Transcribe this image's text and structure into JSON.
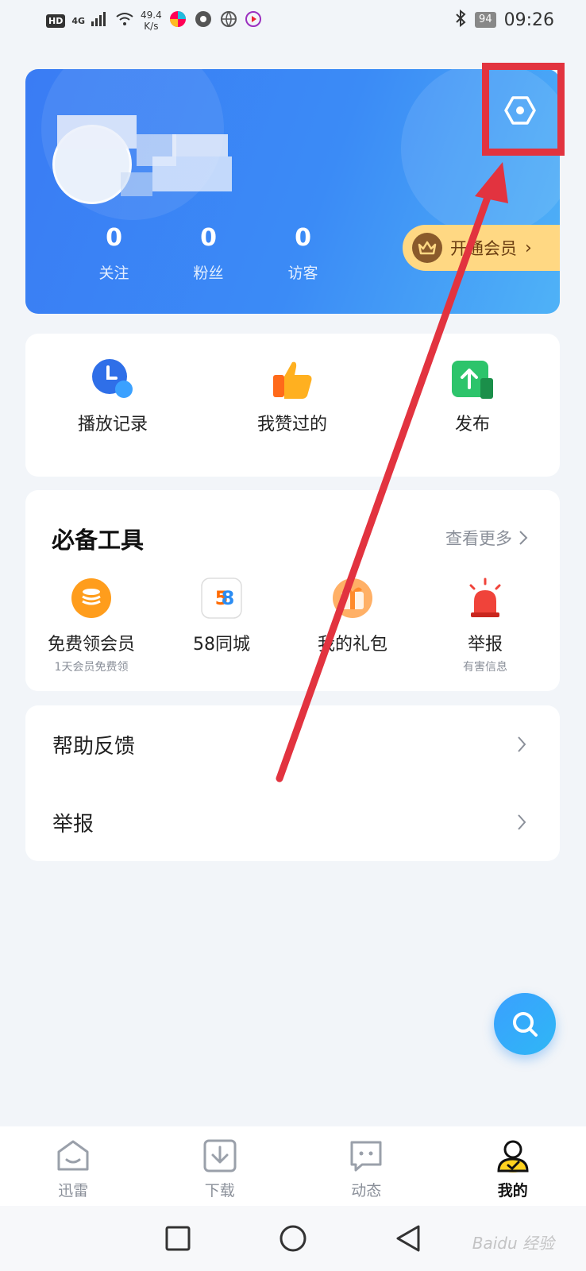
{
  "status_bar": {
    "hd": "HD",
    "network": "4G",
    "speed_value": "49.4",
    "speed_unit": "K/s",
    "battery": "94",
    "time": "09:26"
  },
  "profile": {
    "stats": [
      {
        "value": "0",
        "label": "关注"
      },
      {
        "value": "0",
        "label": "粉丝"
      },
      {
        "value": "0",
        "label": "访客"
      }
    ],
    "vip_label": "开通会员",
    "vip_chevron": "›"
  },
  "quick_actions": [
    {
      "label": "播放记录",
      "icon": "clock-icon"
    },
    {
      "label": "我赞过的",
      "icon": "thumbs-up-icon"
    },
    {
      "label": "发布",
      "icon": "upload-icon"
    }
  ],
  "tools": {
    "title": "必备工具",
    "more_label": "查看更多",
    "items": [
      {
        "label": "免费领会员",
        "sub": "1天会员免费领",
        "icon": "coin-stack-icon"
      },
      {
        "label": "58同城",
        "sub": "",
        "icon": "58-logo-icon"
      },
      {
        "label": "我的礼包",
        "sub": "",
        "icon": "gift-icon"
      },
      {
        "label": "举报",
        "sub": "有害信息",
        "icon": "alarm-icon"
      }
    ]
  },
  "menu": [
    {
      "label": "帮助反馈"
    },
    {
      "label": "举报"
    }
  ],
  "tabbar": [
    {
      "label": "迅雷",
      "icon": "home-icon",
      "active": false
    },
    {
      "label": "下载",
      "icon": "download-icon",
      "active": false
    },
    {
      "label": "动态",
      "icon": "chat-icon",
      "active": false
    },
    {
      "label": "我的",
      "icon": "profile-icon",
      "active": true
    }
  ],
  "watermark": "Baidu 经验",
  "colors": {
    "brand_blue": "#3a7cf4",
    "annotation_red": "#e2333f",
    "vip_gold": "#ffd883"
  }
}
